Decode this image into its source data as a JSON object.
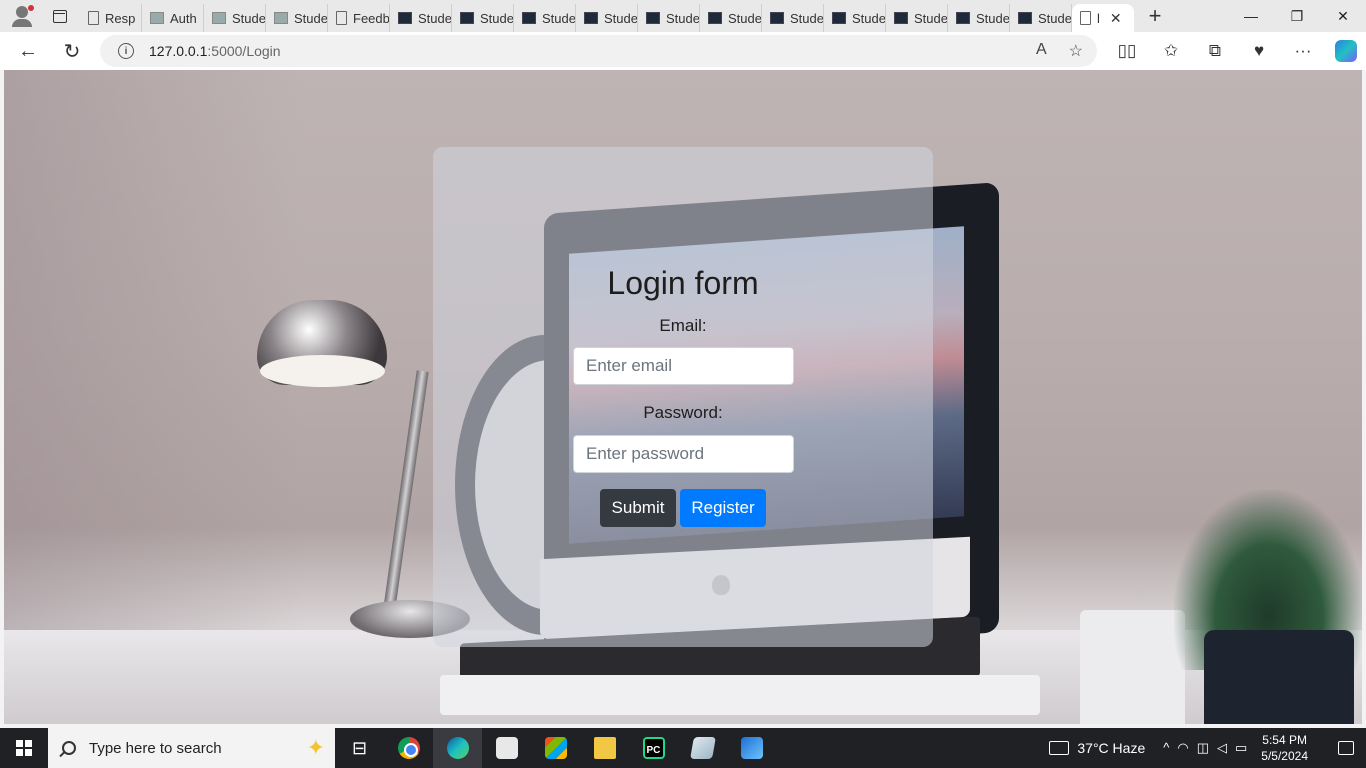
{
  "browser": {
    "tabs": [
      {
        "label": "Resp",
        "icon": "doc-icon"
      },
      {
        "label": "Auth",
        "icon": "image-icon"
      },
      {
        "label": "Stude",
        "icon": "image-icon"
      },
      {
        "label": "Stude",
        "icon": "image-icon"
      },
      {
        "label": "Feedb",
        "icon": "doc-icon"
      },
      {
        "label": "Stude",
        "icon": "terminal-icon"
      },
      {
        "label": "Stude",
        "icon": "terminal-icon"
      },
      {
        "label": "Stude",
        "icon": "terminal-icon"
      },
      {
        "label": "Stude",
        "icon": "terminal-icon"
      },
      {
        "label": "Stude",
        "icon": "terminal-icon"
      },
      {
        "label": "Stude",
        "icon": "terminal-icon"
      },
      {
        "label": "Stude",
        "icon": "terminal-icon"
      },
      {
        "label": "Stude",
        "icon": "terminal-icon"
      },
      {
        "label": "Stude",
        "icon": "terminal-icon"
      },
      {
        "label": "Stude",
        "icon": "terminal-icon"
      },
      {
        "label": "Stude",
        "icon": "terminal-icon"
      }
    ],
    "active_tab": {
      "label": "l",
      "close": "✕"
    },
    "new_tab": "+",
    "window_controls": {
      "minimize": "—",
      "restore": "❐",
      "close": "✕"
    },
    "url_host": "127.0.0.1",
    "url_rest": ":5000/Login",
    "nav": {
      "back": "←",
      "refresh": "↻"
    },
    "info_icon": "i",
    "read_aloud_icon": "A",
    "favorite_icon": "☆",
    "toolbar_icons": {
      "split": "▯▯",
      "favorites": "✩",
      "collections": "⧉",
      "performance": "♥",
      "more": "···"
    }
  },
  "login": {
    "title": "Login form",
    "email_label": "Email:",
    "email_placeholder": "Enter email",
    "password_label": "Password:",
    "password_placeholder": "Enter password",
    "submit_label": "Submit",
    "register_label": "Register",
    "colors": {
      "submit": "#343a40",
      "register": "#007bff"
    }
  },
  "taskbar": {
    "search_placeholder": "Type here to search",
    "task_view_icon": "⊟",
    "weather": "37°C  Haze",
    "tray_chevron": "^",
    "time": "5:54 PM",
    "date": "5/5/2024"
  }
}
